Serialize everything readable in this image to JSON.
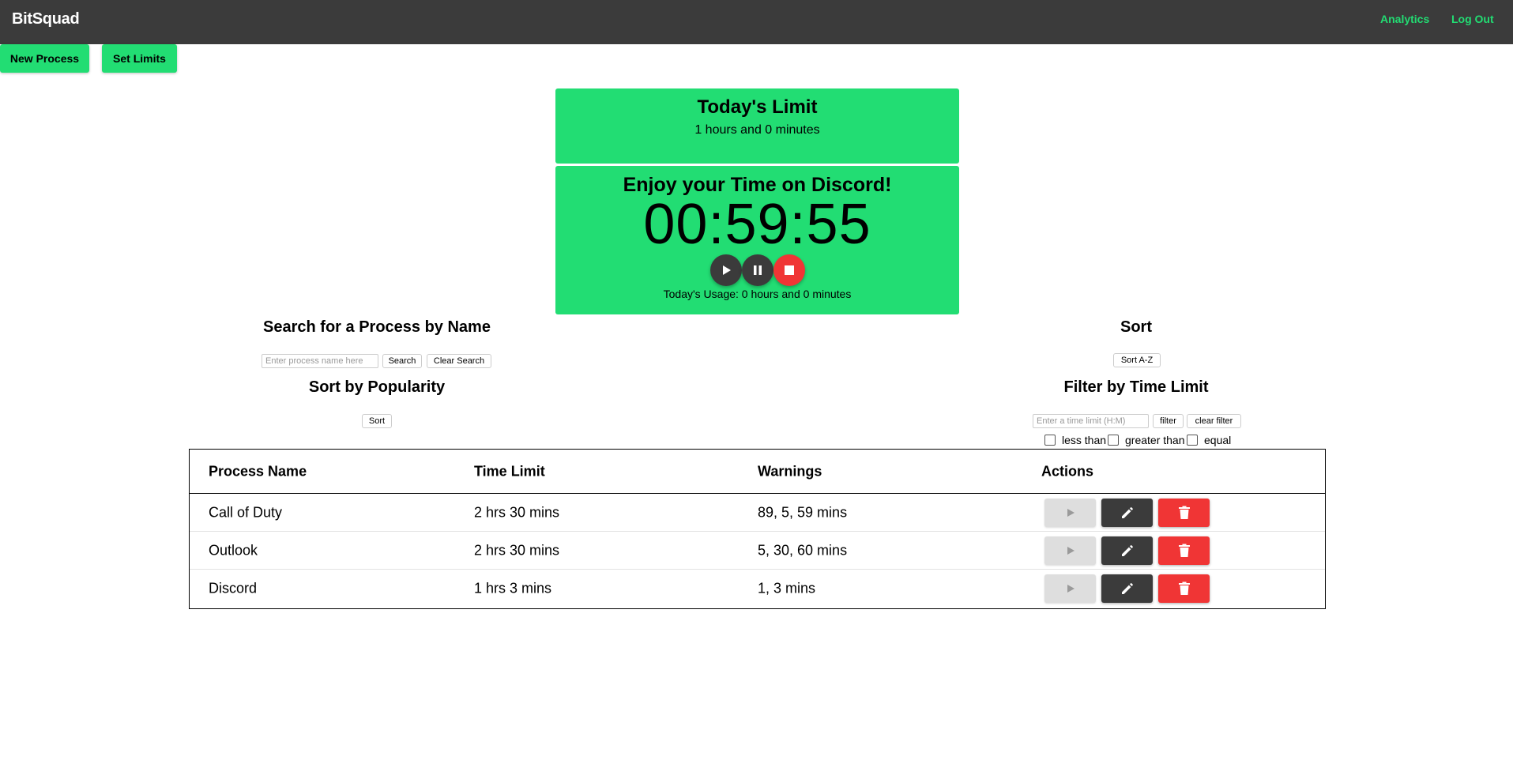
{
  "navbar": {
    "brand": "BitSquad",
    "links": [
      "Analytics",
      "Log Out"
    ],
    "link_color": "#22dd73",
    "background": "#3b3b3b"
  },
  "toolbar": {
    "new_process_label": "New Process",
    "set_limits_label": "Set Limits"
  },
  "limit_panel": {
    "title": "Today's Limit",
    "value": "1 hours and 0 minutes"
  },
  "timer_panel": {
    "message": "Enjoy your Time on Discord!",
    "time": "00:59:55",
    "usage": "Today's Usage: 0 hours and 0 minutes",
    "controls": [
      "play-icon",
      "pause-icon",
      "stop-icon"
    ]
  },
  "search": {
    "title": "Search for a Process by Name",
    "placeholder": "Enter process name here",
    "search_label": "Search",
    "clear_label": "Clear Search"
  },
  "sort": {
    "title": "Sort",
    "button_label": "Sort A-Z"
  },
  "popularity": {
    "title": "Sort by Popularity",
    "button_label": "Sort"
  },
  "filter": {
    "title": "Filter by Time Limit",
    "placeholder": "Enter a time limit (H:M)",
    "filter_label": "filter",
    "clear_label": "clear filter",
    "options": [
      "less than",
      "greater than",
      "equal"
    ]
  },
  "table": {
    "headers": [
      "Process Name",
      "Time Limit",
      "Warnings",
      "Actions"
    ],
    "rows": [
      {
        "name": "Call of Duty",
        "limit": "2 hrs 30 mins",
        "warnings": "89, 5, 59 mins"
      },
      {
        "name": "Outlook",
        "limit": "2 hrs 30 mins",
        "warnings": "5, 30, 60 mins"
      },
      {
        "name": "Discord",
        "limit": "1 hrs 3 mins",
        "warnings": "1, 3 mins"
      }
    ],
    "action_icons": [
      "play-icon",
      "pencil-icon",
      "trash-icon"
    ]
  },
  "colors": {
    "accent_green": "#22dd73",
    "danger_red": "#f03535",
    "dark": "#3b3b3b",
    "disabled_gray": "#dedede"
  }
}
